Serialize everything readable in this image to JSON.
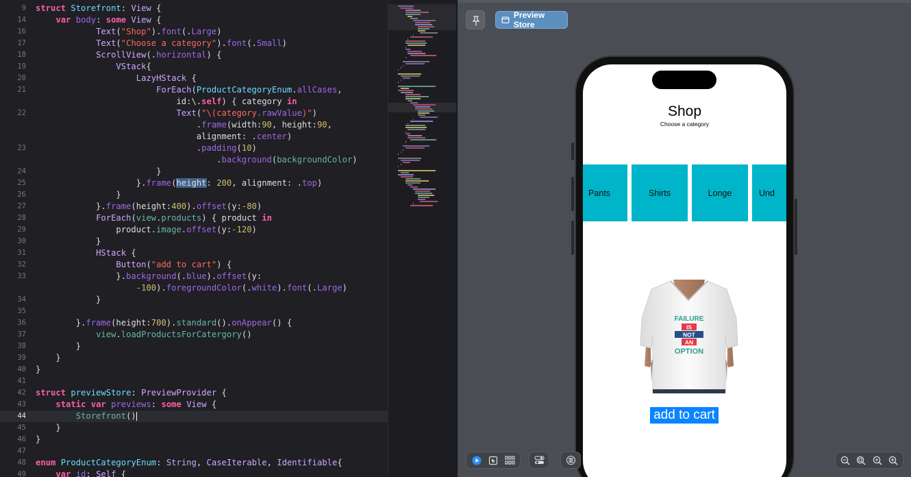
{
  "editor": {
    "lines": [
      {
        "n": "9",
        "html": "<span class='kw'>struct</span> <span class='tyb'>Storefront</span>: <span class='ty'>View</span> {"
      },
      {
        "n": "14",
        "html": "    <span class='kw'>var</span> <span class='pr'>body</span>: <span class='kw'>some</span> <span class='ty'>View</span> {"
      },
      {
        "n": "16",
        "html": "            <span class='ty'>Text</span>(<span class='str'>\"Shop\"</span>).<span class='pr'>font</span>(.<span class='pr'>Large</span>)"
      },
      {
        "n": "17",
        "html": "            <span class='ty'>Text</span>(<span class='str'>\"Choose a category\"</span>).<span class='pr'>font</span>(.<span class='pr'>Small</span>)"
      },
      {
        "n": "18",
        "html": "            <span class='ty'>ScrollView</span>(.<span class='pr'>horizontal</span>) {"
      },
      {
        "n": "19",
        "html": "                <span class='ty'>VStack</span>{"
      },
      {
        "n": "20",
        "html": "                    <span class='ty'>LazyHStack</span> {"
      },
      {
        "n": "21",
        "html": "                        <span class='ty'>ForEach</span>(<span class='tyb'>ProductCategoryEnum</span>.<span class='pr'>allCases</span>,"
      },
      {
        "n": "",
        "html": "                            id:\\.<span class='kw'>self</span>) { category <span class='kw'>in</span>"
      },
      {
        "n": "22",
        "html": "                            <span class='ty'>Text</span>(<span class='str'>\"\\(category.<span class='pr'>rawValue</span>)\"</span>)"
      },
      {
        "n": "",
        "html": "                                .<span class='pr'>frame</span>(width:<span class='num'>90</span>, height:<span class='num'>90</span>,"
      },
      {
        "n": "",
        "html": "                                alignment: .<span class='pr'>center</span>)"
      },
      {
        "n": "23",
        "html": "                                .<span class='pr'>padding</span>(<span class='num'>10</span>)"
      },
      {
        "n": "",
        "html": "                                    .<span class='pr'>background</span>(<span class='fn'>backgroundColor</span>)"
      },
      {
        "n": "24",
        "html": "                        }"
      },
      {
        "n": "25",
        "html": "                    }.<span class='pr'>frame</span>(<span class='sel'>height</span>: <span class='num'>200</span>, alignment: .<span class='pr'>top</span>)"
      },
      {
        "n": "26",
        "html": "                }"
      },
      {
        "n": "27",
        "html": "            }.<span class='pr'>frame</span>(height:<span class='num'>400</span>).<span class='pr'>offset</span>(y:<span class='num'>-80</span>)"
      },
      {
        "n": "28",
        "html": "            <span class='ty'>ForEach</span>(<span class='fn'>view</span>.<span class='fn'>products</span>) { product <span class='kw'>in</span>"
      },
      {
        "n": "29",
        "html": "                product.<span class='fn'>image</span>.<span class='pr'>offset</span>(y:<span class='num'>-120</span>)"
      },
      {
        "n": "30",
        "html": "            }"
      },
      {
        "n": "31",
        "html": "            <span class='ty'>HStack</span> {"
      },
      {
        "n": "32",
        "html": "                <span class='ty'>Button</span>(<span class='str'>\"add to cart\"</span>) {"
      },
      {
        "n": "33",
        "html": "                }.<span class='pr'>background</span>(.<span class='pr'>blue</span>).<span class='pr'>offset</span>(y:"
      },
      {
        "n": "",
        "html": "                    <span class='num'>-100</span>).<span class='pr'>foregroundColor</span>(.<span class='pr'>white</span>).<span class='pr'>font</span>(.<span class='pr'>Large</span>)"
      },
      {
        "n": "34",
        "html": "            }"
      },
      {
        "n": "35",
        "html": ""
      },
      {
        "n": "36",
        "html": "        }.<span class='pr'>frame</span>(height:<span class='num'>700</span>).<span class='fn'>standard</span>().<span class='pr'>onAppear</span>() {"
      },
      {
        "n": "37",
        "html": "            <span class='fn'>view</span>.<span class='fn'>loadProductsForCatergory</span>()"
      },
      {
        "n": "38",
        "html": "        }"
      },
      {
        "n": "39",
        "html": "    }"
      },
      {
        "n": "40",
        "html": "}"
      },
      {
        "n": "41",
        "html": ""
      },
      {
        "n": "42",
        "html": "<span class='kw'>struct</span> <span class='tyb'>previewStore</span>: <span class='ty'>PreviewProvider</span> {"
      },
      {
        "n": "43",
        "html": "    <span class='kw'>static</span> <span class='kw'>var</span> <span class='pr'>previews</span>: <span class='kw'>some</span> <span class='ty'>View</span> {"
      },
      {
        "n": "44",
        "html": "        <span class='fn'>Storefront</span>()<span class='caret'></span>",
        "current": true
      },
      {
        "n": "45",
        "html": "    }"
      },
      {
        "n": "46",
        "html": "}"
      },
      {
        "n": "47",
        "html": ""
      },
      {
        "n": "48",
        "html": "<span class='kw'>enum</span> <span class='tyb'>ProductCategoryEnum</span>: <span class='ty'>String</span>, <span class='ty'>CaseIterable</span>, <span class='ty'>Identifiable</span>{"
      },
      {
        "n": "49",
        "html": "    <span class='kw'>var</span> <span class='pr'>id</span>: <span class='ty'>Self</span> {"
      }
    ]
  },
  "preview": {
    "pin_icon": "pin-icon",
    "store_button_label": "Preview Store",
    "store_button_icon": "window-icon",
    "shop_title": "Shop",
    "shop_subtitle": "Choose a category",
    "categories": [
      "Pants",
      "Shirts",
      "Longe",
      "Und"
    ],
    "category_color": "#00b5c9",
    "tshirt_lines": [
      "FAILURE",
      "IS",
      "NOT",
      "AN",
      "OPTION"
    ],
    "add_to_cart": "add to cart",
    "add_to_cart_color": "#0a84ff",
    "bottom_left_icons": [
      "play-icon",
      "select-icon",
      "grid-icon"
    ],
    "bottom_mid_icons": [
      "device-settings-icon"
    ],
    "bottom_info_icon": "variants-icon",
    "zoom_icons": [
      "zoom-out-icon",
      "zoom-fit-icon",
      "zoom-100-icon",
      "zoom-in-icon"
    ]
  }
}
